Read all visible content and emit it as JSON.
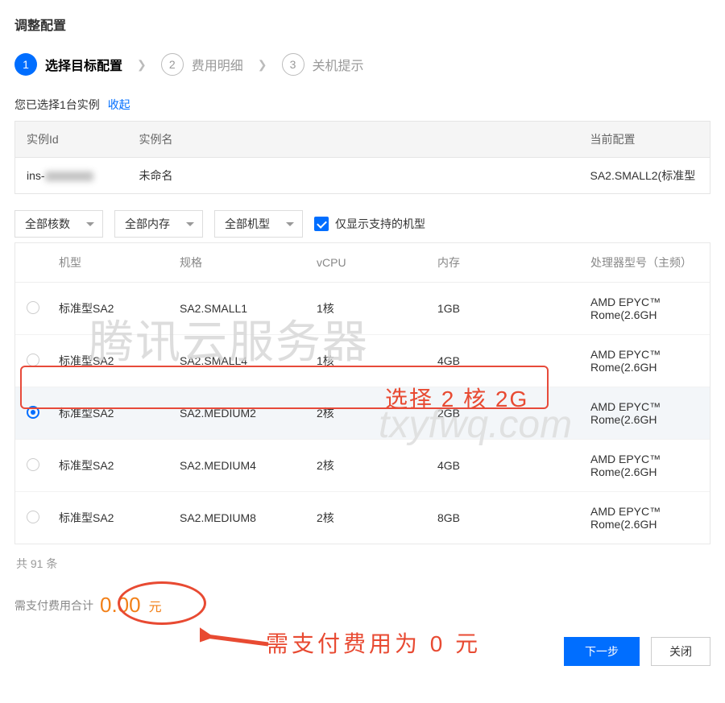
{
  "title": "调整配置",
  "steps": [
    {
      "num": "1",
      "label": "选择目标配置",
      "active": true
    },
    {
      "num": "2",
      "label": "费用明细",
      "active": false
    },
    {
      "num": "3",
      "label": "关机提示",
      "active": false
    }
  ],
  "selected_line": {
    "prefix": "您已选择1台实例",
    "collapse": "收起"
  },
  "instance_table": {
    "headers": {
      "id": "实例Id",
      "name": "实例名",
      "cfg": "当前配置"
    },
    "row": {
      "id_prefix": "ins-",
      "name": "未命名",
      "cfg": "SA2.SMALL2(标准型"
    }
  },
  "filters": {
    "cores": "全部核数",
    "mem": "全部内存",
    "type": "全部机型",
    "only_supported": "仅显示支持的机型"
  },
  "spec_headers": {
    "model": "机型",
    "spec": "规格",
    "vcpu": "vCPU",
    "mem": "内存",
    "proc": "处理器型号（主频）"
  },
  "specs": [
    {
      "model": "标准型SA2",
      "spec": "SA2.SMALL1",
      "vcpu": "1核",
      "mem": "1GB",
      "proc": "AMD EPYC™ Rome(2.6GH",
      "selected": false
    },
    {
      "model": "标准型SA2",
      "spec": "SA2.SMALL4",
      "vcpu": "1核",
      "mem": "4GB",
      "proc": "AMD EPYC™ Rome(2.6GH",
      "selected": false
    },
    {
      "model": "标准型SA2",
      "spec": "SA2.MEDIUM2",
      "vcpu": "2核",
      "mem": "2GB",
      "proc": "AMD EPYC™ Rome(2.6GH",
      "selected": true
    },
    {
      "model": "标准型SA2",
      "spec": "SA2.MEDIUM4",
      "vcpu": "2核",
      "mem": "4GB",
      "proc": "AMD EPYC™ Rome(2.6GH",
      "selected": false
    },
    {
      "model": "标准型SA2",
      "spec": "SA2.MEDIUM8",
      "vcpu": "2核",
      "mem": "8GB",
      "proc": "AMD EPYC™ Rome(2.6GH",
      "selected": false
    }
  ],
  "total_count": "共 91 条",
  "pay": {
    "label": "需支付费用合计",
    "amount": "0.00",
    "unit": "元"
  },
  "buttons": {
    "next": "下一步",
    "close": "关闭"
  },
  "annotations": {
    "watermark1": "腾讯云服务器",
    "watermark2": "txyfwq.com",
    "note1": "选择 2 核 2G",
    "note2": "需支付费用为 0 元"
  }
}
